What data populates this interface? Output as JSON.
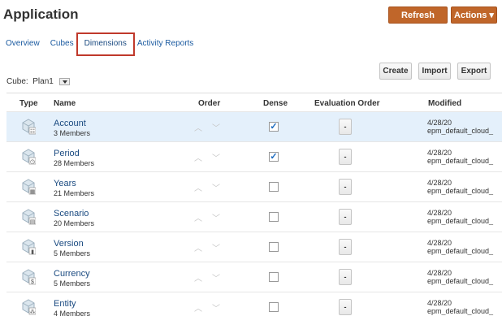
{
  "header": {
    "title": "Application",
    "refresh_label": "Refresh",
    "actions_label": "Actions ▾"
  },
  "tabs": [
    {
      "label": "Overview"
    },
    {
      "label": "Cubes"
    },
    {
      "label": "Dimensions",
      "selected": true
    },
    {
      "label": "Activity Reports"
    }
  ],
  "toolbar": {
    "create": "Create",
    "import": "Import",
    "export": "Export"
  },
  "cube": {
    "label": "Cube:",
    "value": "Plan1"
  },
  "columns": {
    "type": "Type",
    "name": "Name",
    "order": "Order",
    "dense": "Dense",
    "eval": "Evaluation Order",
    "modified": "Modified"
  },
  "rows": [
    {
      "name": "Account",
      "members": "3 Members",
      "dense": true,
      "eval": "-",
      "date": "4/28/20",
      "user": "epm_default_cloud_",
      "selected": true,
      "badge": "☷"
    },
    {
      "name": "Period",
      "members": "28 Members",
      "dense": true,
      "eval": "-",
      "date": "4/28/20",
      "user": "epm_default_cloud_",
      "badge": "◷"
    },
    {
      "name": "Years",
      "members": "21 Members",
      "dense": false,
      "eval": "-",
      "date": "4/28/20",
      "user": "epm_default_cloud_",
      "badge": "▦"
    },
    {
      "name": "Scenario",
      "members": "20 Members",
      "dense": false,
      "eval": "-",
      "date": "4/28/20",
      "user": "epm_default_cloud_",
      "badge": "▤"
    },
    {
      "name": "Version",
      "members": "5 Members",
      "dense": false,
      "eval": "-",
      "date": "4/28/20",
      "user": "epm_default_cloud_",
      "badge": "▮"
    },
    {
      "name": "Currency",
      "members": "5 Members",
      "dense": false,
      "eval": "-",
      "date": "4/28/20",
      "user": "epm_default_cloud_",
      "badge": "$"
    },
    {
      "name": "Entity",
      "members": "4 Members",
      "dense": false,
      "eval": "-",
      "date": "4/28/20",
      "user": "epm_default_cloud_",
      "badge": "⁂"
    }
  ],
  "colors": {
    "accent": "#c0662a",
    "link": "#1a4a80",
    "selected_row": "#e4f0fb",
    "highlight_box": "#c0392b"
  }
}
